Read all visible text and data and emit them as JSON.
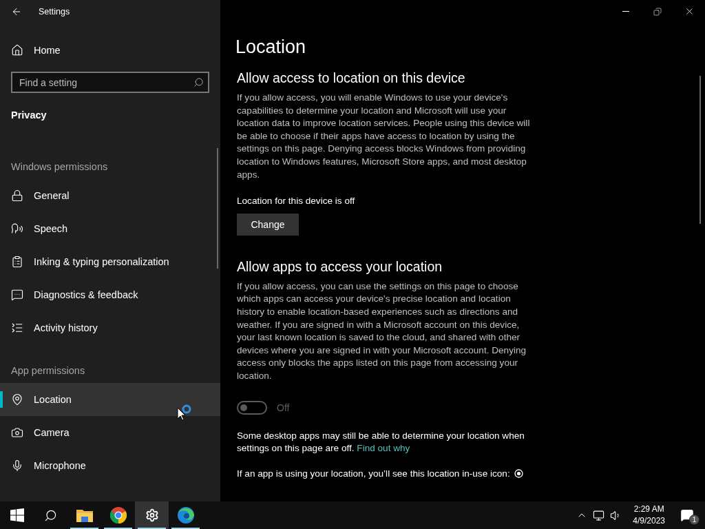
{
  "window": {
    "title": "Settings"
  },
  "sidebar": {
    "home": "Home",
    "search": {
      "placeholder": "Find a setting"
    },
    "category": "Privacy",
    "sections": [
      {
        "heading": "Windows permissions",
        "items": [
          {
            "label": "General",
            "kind": "lock",
            "selected": false
          },
          {
            "label": "Speech",
            "kind": "speech",
            "selected": false
          },
          {
            "label": "Inking & typing personalization",
            "kind": "clipboard",
            "selected": false
          },
          {
            "label": "Diagnostics & feedback",
            "kind": "feedback",
            "selected": false
          },
          {
            "label": "Activity history",
            "kind": "activity",
            "selected": false
          }
        ]
      },
      {
        "heading": "App permissions",
        "items": [
          {
            "label": "Location",
            "kind": "location",
            "selected": true
          },
          {
            "label": "Camera",
            "kind": "camera",
            "selected": false
          },
          {
            "label": "Microphone",
            "kind": "microphone",
            "selected": false
          }
        ]
      }
    ]
  },
  "main": {
    "title": "Location",
    "device_section": {
      "heading": "Allow access to location on this device",
      "body": "If you allow access, you will enable Windows to use your device's capabilities to determine your location and Microsoft will use your location data to improve location services. People using this device will be able to choose if their apps have access to location by using the settings on this page. Denying access blocks Windows from providing location to Windows features, Microsoft Store apps, and most desktop apps.",
      "status": "Location for this device is off",
      "button": "Change"
    },
    "apps_section": {
      "heading": "Allow apps to access your location",
      "body": "If you allow access, you can use the settings on this page to choose which apps can access your device's precise location and location history to enable location-based experiences such as directions and weather. If you are signed in with a Microsoft account on this device, your last known location is saved to the cloud, and shared with other devices where you are signed in with your Microsoft account. Denying access only blocks the apps listed on this page from accessing your location.",
      "toggle": {
        "on": false,
        "label": "Off"
      },
      "note": "Some desktop apps may still be able to determine your location when settings on this page are off.",
      "note_link": "Find out why",
      "in_use_text": "If an app is using your location, you’ll see this location in-use icon:"
    }
  },
  "taskbar": {
    "items": [
      {
        "kind": "start",
        "running": false,
        "selected": false
      },
      {
        "kind": "search",
        "running": false,
        "selected": false
      },
      {
        "kind": "explorer",
        "running": true,
        "selected": false
      },
      {
        "kind": "chrome",
        "running": true,
        "selected": false
      },
      {
        "kind": "settings",
        "running": true,
        "selected": true
      },
      {
        "kind": "edge",
        "running": true,
        "selected": false
      }
    ],
    "time": "2:29 AM",
    "date": "4/9/2023",
    "notifications": "1"
  }
}
